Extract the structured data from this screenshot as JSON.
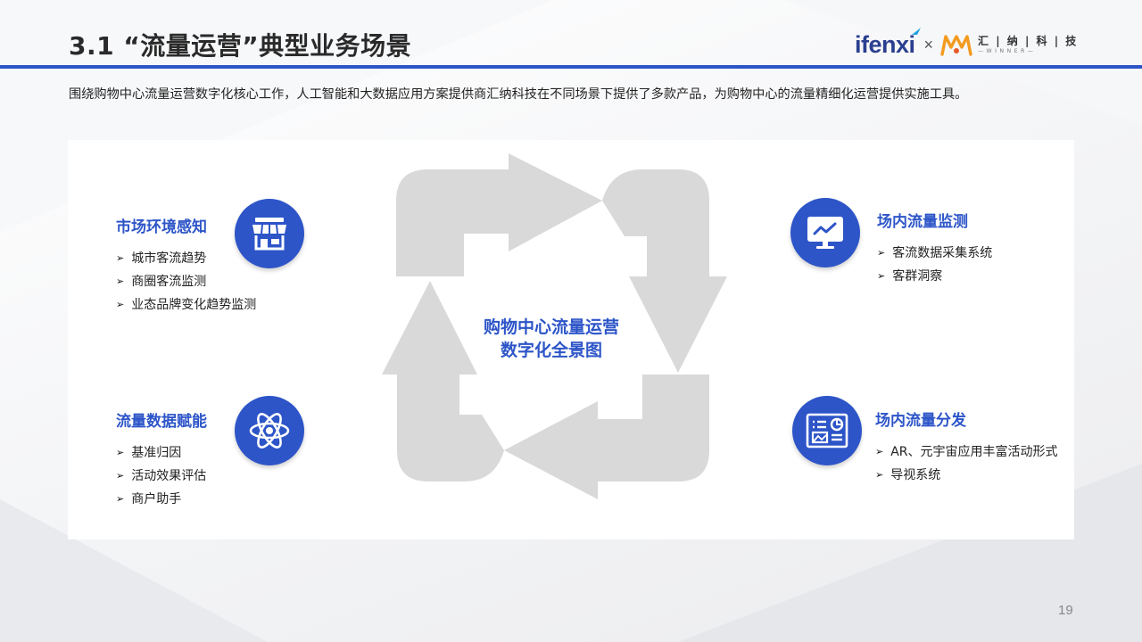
{
  "header": {
    "title": "3.1 “流量运营”典型业务场景",
    "logo_ifenxi": "ifenxi",
    "logo_times": "×",
    "logo_winner_cn": "汇 | 纳 | 科 | 技",
    "logo_winner_en": "—WINNER—"
  },
  "intro": "围绕购物中心流量运营数字化核心工作，人工智能和大数据应用方案提供商汇纳科技在不同场景下提供了多款产品，为购物中心的流量精细化运营提供实施工具。",
  "center": {
    "line1": "购物中心流量运营",
    "line2": "数字化全景图"
  },
  "groups": {
    "market": {
      "title": "市场环境感知",
      "icon": "store-icon",
      "items": [
        "城市客流趋势",
        "商圈客流监测",
        "业态品牌变化趋势监测"
      ]
    },
    "monitor": {
      "title": "场内流量监测",
      "icon": "monitor-chart-icon",
      "items": [
        "客流数据采集系统",
        "客群洞察"
      ]
    },
    "empower": {
      "title": "流量数据赋能",
      "icon": "atom-icon",
      "items": [
        "基准归因",
        "活动效果评估",
        "商户助手"
      ]
    },
    "distribute": {
      "title": "场内流量分发",
      "icon": "dashboard-icon",
      "items": [
        "AR、元宇宙应用丰富活动形式",
        "导视系统"
      ]
    }
  },
  "bullet": "➢",
  "page_number": "19",
  "colors": {
    "accent": "#2d55c8",
    "arrow_gray": "#d9d9d9",
    "logo_orange": "#f39a1e",
    "logo_navy": "#2a3f8f"
  }
}
